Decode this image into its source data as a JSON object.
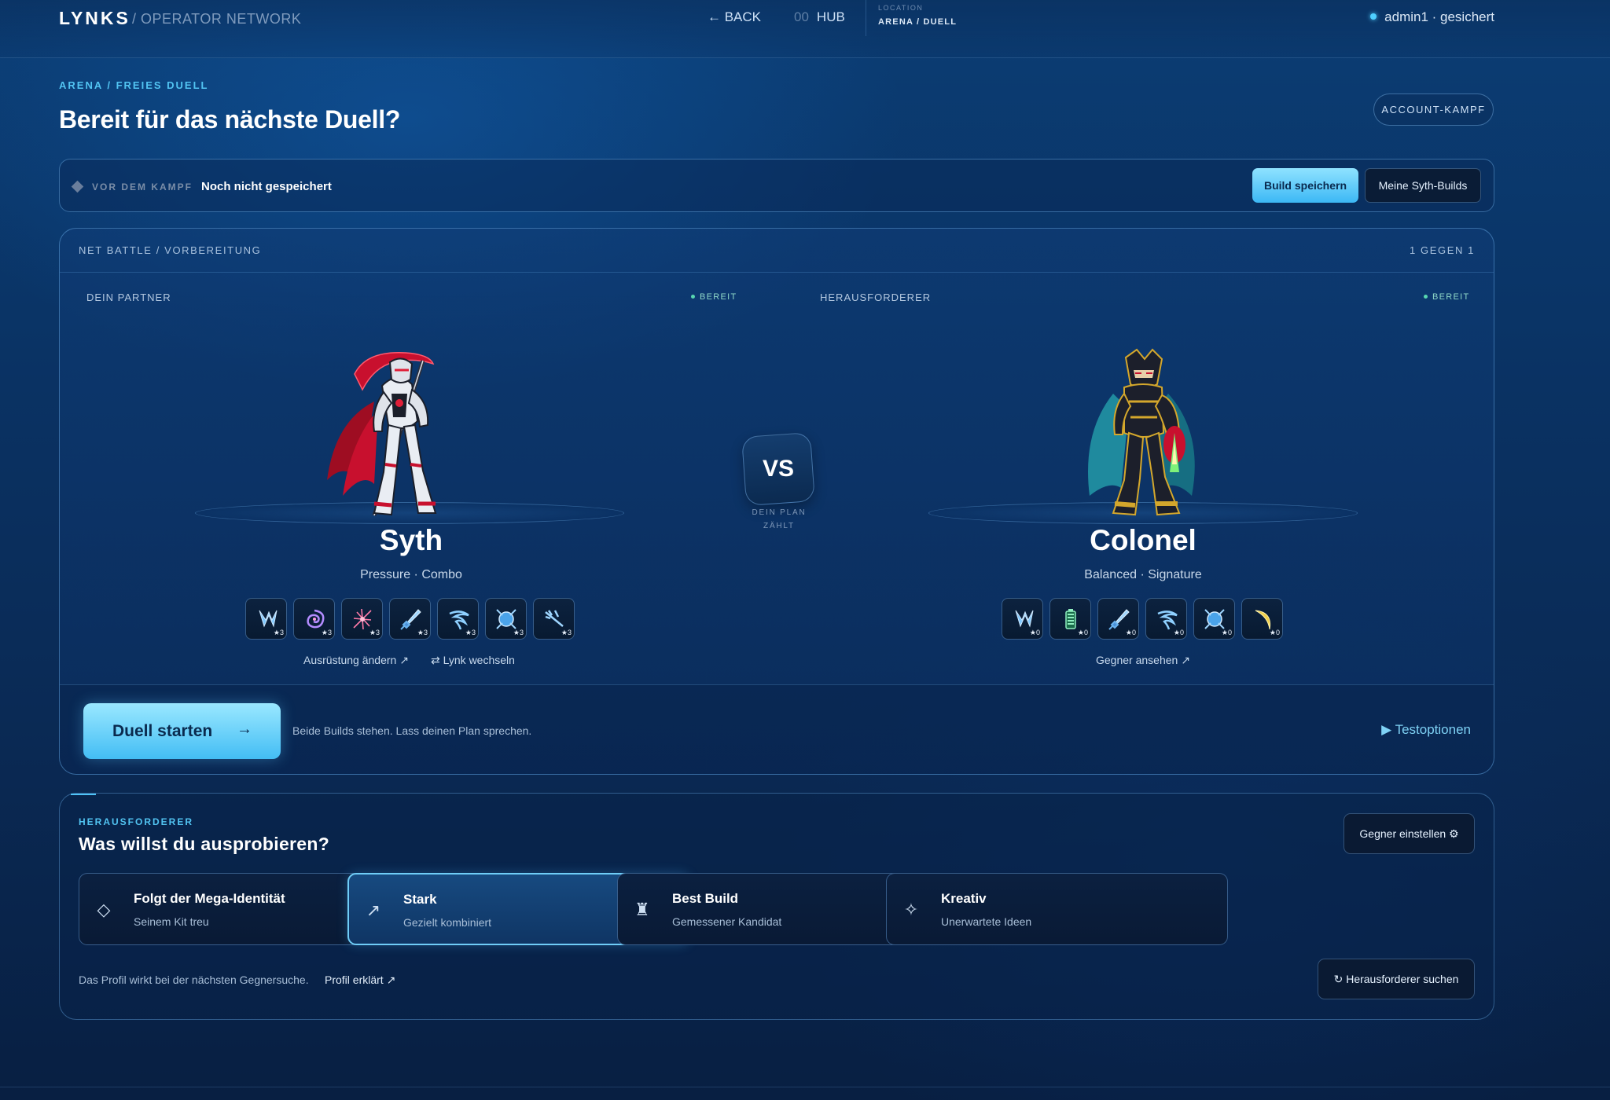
{
  "topbar": {
    "brand": "LYNKS",
    "brand_sub": "/ OPERATOR NETWORK",
    "back": "← BACK",
    "hub_num": "00",
    "hub": "HUB",
    "location_label": "LOCATION",
    "location_value": "ARENA / DUELL",
    "user": "admin1 · gesichert"
  },
  "header": {
    "breadcrumb": "ARENA / FREIES DUELL",
    "title": "Bereit für das nächste Duell?",
    "account_button": "ACCOUNT-KAMPF"
  },
  "savebar": {
    "label": "VOR DEM KAMPF",
    "status": "Noch nicht gespeichert",
    "save_button": "Build speichern",
    "builds_button": "Meine Syth-Builds"
  },
  "battle": {
    "title": "NET BATTLE / VORBEREITUNG",
    "mode": "1 GEGEN 1",
    "vs": "VS",
    "vs_caption": "DEIN PLAN ZÄHLT",
    "left": {
      "label": "DEIN PARTNER",
      "status": "BEREIT",
      "name": "Syth",
      "tags": "Pressure · Combo",
      "chips": [
        {
          "icon": "claw-chip-icon",
          "star": "★3"
        },
        {
          "icon": "vortex-chip-icon",
          "star": "★3"
        },
        {
          "icon": "slash-burst-chip-icon",
          "star": "★3"
        },
        {
          "icon": "sword-chip-icon",
          "star": "★3"
        },
        {
          "icon": "whirlwind-chip-icon",
          "star": "★3"
        },
        {
          "icon": "shield-break-chip-icon",
          "star": "★3"
        },
        {
          "icon": "lance-chip-icon",
          "star": "★3"
        }
      ],
      "link_equipment": "Ausrüstung ändern ↗",
      "link_switch": "⇄ Lynk wechseln"
    },
    "right": {
      "label": "HERAUSFORDERER",
      "status": "BEREIT",
      "name": "Colonel",
      "tags": "Balanced · Signature",
      "chips": [
        {
          "icon": "claw-chip-icon",
          "star": "★0"
        },
        {
          "icon": "battery-chip-icon",
          "star": "★0"
        },
        {
          "icon": "sword-chip-icon",
          "star": "★0"
        },
        {
          "icon": "whirlwind-chip-icon",
          "star": "★0"
        },
        {
          "icon": "shield-break-chip-icon",
          "star": "★0"
        },
        {
          "icon": "crescent-chip-icon",
          "star": "★0"
        }
      ],
      "link_view": "Gegner ansehen ↗"
    },
    "start_button": "Duell starten",
    "start_arrow": "→",
    "hint": "Beide Builds stehen. Lass deinen Plan sprechen.",
    "test_options": "▶ Testoptionen"
  },
  "challenger": {
    "label": "HERAUSFORDERER",
    "title": "Was willst du ausprobieren?",
    "settings_button": "Gegner einstellen ⚙",
    "options": [
      {
        "title": "Folgt der Mega-Identität",
        "sub": "Seinem Kit treu",
        "icon": "diamond-icon",
        "glyph": "◇"
      },
      {
        "title": "Stark",
        "sub": "Gezielt kombiniert",
        "icon": "arrow-up-right-icon",
        "glyph": "↗"
      },
      {
        "title": "Best Build",
        "sub": "Gemessener Kandidat",
        "icon": "rook-icon",
        "glyph": "♜"
      },
      {
        "title": "Kreativ",
        "sub": "Unerwartete Ideen",
        "icon": "sparkle-icon",
        "glyph": "✧"
      }
    ],
    "selected_option": "Stark",
    "hint": "Das Profil wirkt bei der nächsten Gegnersuche.",
    "link": "Profil erklärt ↗",
    "search_button": "↻ Herausforderer suchen"
  },
  "colors": {
    "accent": "#4fc3f7",
    "primary_button": "#5ccaf6",
    "ready": "#57d6b0",
    "syth_red": "#c8102e",
    "colonel_teal": "#1f8a9e"
  }
}
